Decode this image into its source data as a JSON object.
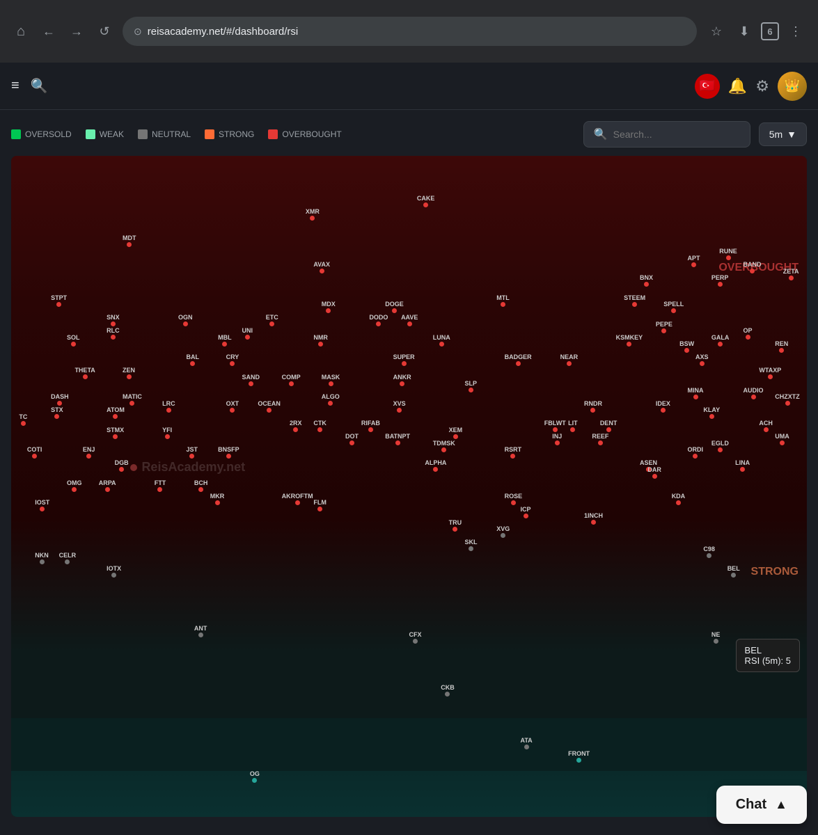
{
  "browser": {
    "url": "reisacademy.net/#/dashboard/rsi",
    "tab_count": "6",
    "nav": {
      "home": "⌂",
      "back": "←",
      "forward": "→",
      "refresh": "↺",
      "bookmark": "☆",
      "download": "⬇",
      "more": "⋮"
    }
  },
  "header": {
    "hamburger": "≡",
    "search": "🔍",
    "flag": "🇹🇷",
    "bell": "🔔",
    "settings": "⚙"
  },
  "dashboard": {
    "legend": [
      {
        "label": "OVERSOLD",
        "class": "dot-oversold"
      },
      {
        "label": "WEAK",
        "class": "dot-weak"
      },
      {
        "label": "NEUTRAL",
        "class": "dot-neutral"
      },
      {
        "label": "STRONG",
        "class": "dot-strong"
      },
      {
        "label": "OVERBOUGHT",
        "class": "dot-overbought"
      }
    ],
    "search_placeholder": "Search...",
    "time_selector": "5m",
    "watermark": "ReisAcademy.net",
    "zone_labels": {
      "overbought": "OVERBOUGHT",
      "strong": "STRONG"
    },
    "tooltip": {
      "token": "BEL",
      "rsi_label": "RSI (5m): 5"
    }
  },
  "tokens": [
    {
      "id": "XMR",
      "x": "37%",
      "y": "8%",
      "dot": "dot-red"
    },
    {
      "id": "CAKE",
      "x": "51%",
      "y": "6%",
      "dot": "dot-red"
    },
    {
      "id": "MDT",
      "x": "14%",
      "y": "12%",
      "dot": "dot-red"
    },
    {
      "id": "AVAX",
      "x": "38%",
      "y": "16%",
      "dot": "dot-red"
    },
    {
      "id": "MDX",
      "x": "39%",
      "y": "22%",
      "dot": "dot-red"
    },
    {
      "id": "STPT",
      "x": "5%",
      "y": "21%",
      "dot": "dot-red"
    },
    {
      "id": "SOL",
      "x": "7%",
      "y": "27%",
      "dot": "dot-red"
    },
    {
      "id": "SNX",
      "x": "12%",
      "y": "24%",
      "dot": "dot-red"
    },
    {
      "id": "RLC",
      "x": "12%",
      "y": "26%",
      "dot": "dot-red"
    },
    {
      "id": "OGN",
      "x": "21%",
      "y": "24%",
      "dot": "dot-red"
    },
    {
      "id": "MBL",
      "x": "26%",
      "y": "27%",
      "dot": "dot-red"
    },
    {
      "id": "UNI",
      "x": "29%",
      "y": "26%",
      "dot": "dot-red"
    },
    {
      "id": "ETC",
      "x": "32%",
      "y": "24%",
      "dot": "dot-red"
    },
    {
      "id": "NMR",
      "x": "38%",
      "y": "27%",
      "dot": "dot-red"
    },
    {
      "id": "DODO",
      "x": "45%",
      "y": "24%",
      "dot": "dot-red"
    },
    {
      "id": "AAVE",
      "x": "49%",
      "y": "24%",
      "dot": "dot-red"
    },
    {
      "id": "LUNA",
      "x": "53%",
      "y": "27%",
      "dot": "dot-red"
    },
    {
      "id": "DOGE",
      "x": "47%",
      "y": "22%",
      "dot": "dot-red"
    },
    {
      "id": "MTL",
      "x": "61%",
      "y": "21%",
      "dot": "dot-red"
    },
    {
      "id": "BAL",
      "x": "22%",
      "y": "30%",
      "dot": "dot-red"
    },
    {
      "id": "CRY",
      "x": "27%",
      "y": "30%",
      "dot": "dot-red"
    },
    {
      "id": "SAND",
      "x": "29%",
      "y": "33%",
      "dot": "dot-red"
    },
    {
      "id": "BNX",
      "x": "79%",
      "y": "18%",
      "dot": "dot-red"
    },
    {
      "id": "APT",
      "x": "85%",
      "y": "15%",
      "dot": "dot-red"
    },
    {
      "id": "RUNE",
      "x": "89%",
      "y": "14%",
      "dot": "dot-red"
    },
    {
      "id": "STEEM",
      "x": "77%",
      "y": "21%",
      "dot": "dot-red"
    },
    {
      "id": "SPELL",
      "x": "82%",
      "y": "22%",
      "dot": "dot-red"
    },
    {
      "id": "PEPE",
      "x": "81%",
      "y": "25%",
      "dot": "dot-red"
    },
    {
      "id": "PERP",
      "x": "88%",
      "y": "18%",
      "dot": "dot-red"
    },
    {
      "id": "BAND",
      "x": "92%",
      "y": "16%",
      "dot": "dot-red"
    },
    {
      "id": "ZETA",
      "x": "97%",
      "y": "17%",
      "dot": "dot-red"
    },
    {
      "id": "BSW",
      "x": "84%",
      "y": "28%",
      "dot": "dot-red"
    },
    {
      "id": "AXS",
      "x": "86%",
      "y": "30%",
      "dot": "dot-red"
    },
    {
      "id": "GALA",
      "x": "88%",
      "y": "27%",
      "dot": "dot-red"
    },
    {
      "id": "OP",
      "x": "92%",
      "y": "26%",
      "dot": "dot-red"
    },
    {
      "id": "REN",
      "x": "96%",
      "y": "28%",
      "dot": "dot-red"
    },
    {
      "id": "KSMKEY",
      "x": "76%",
      "y": "27%",
      "dot": "dot-red"
    },
    {
      "id": "NEAR",
      "x": "69%",
      "y": "30%",
      "dot": "dot-red"
    },
    {
      "id": "BADGER",
      "x": "62%",
      "y": "30%",
      "dot": "dot-red"
    },
    {
      "id": "SUPER",
      "x": "48%",
      "y": "30%",
      "dot": "dot-red"
    },
    {
      "id": "THETA",
      "x": "8%",
      "y": "32%",
      "dot": "dot-red"
    },
    {
      "id": "ZEN",
      "x": "14%",
      "y": "32%",
      "dot": "dot-red"
    },
    {
      "id": "MATIC",
      "x": "14%",
      "y": "36%",
      "dot": "dot-red"
    },
    {
      "id": "DASH",
      "x": "5%",
      "y": "36%",
      "dot": "dot-red"
    },
    {
      "id": "STX",
      "x": "5%",
      "y": "38%",
      "dot": "dot-red"
    },
    {
      "id": "ATOM",
      "x": "12%",
      "y": "38%",
      "dot": "dot-red"
    },
    {
      "id": "LRC",
      "x": "19%",
      "y": "37%",
      "dot": "dot-red"
    },
    {
      "id": "COMP",
      "x": "34%",
      "y": "33%",
      "dot": "dot-red"
    },
    {
      "id": "MASK",
      "x": "39%",
      "y": "33%",
      "dot": "dot-red"
    },
    {
      "id": "ALGO",
      "x": "39%",
      "y": "36%",
      "dot": "dot-red"
    },
    {
      "id": "ANKR",
      "x": "48%",
      "y": "33%",
      "dot": "dot-red"
    },
    {
      "id": "XVS",
      "x": "48%",
      "y": "37%",
      "dot": "dot-red"
    },
    {
      "id": "SLP",
      "x": "57%",
      "y": "34%",
      "dot": "dot-red"
    },
    {
      "id": "IDEX",
      "x": "81%",
      "y": "37%",
      "dot": "dot-red"
    },
    {
      "id": "MINA",
      "x": "85%",
      "y": "35%",
      "dot": "dot-red"
    },
    {
      "id": "KLAY",
      "x": "87%",
      "y": "38%",
      "dot": "dot-red"
    },
    {
      "id": "WTAXP",
      "x": "94%",
      "y": "32%",
      "dot": "dot-red"
    },
    {
      "id": "AUDIO",
      "x": "92%",
      "y": "35%",
      "dot": "dot-red"
    },
    {
      "id": "CHZXTZ",
      "x": "96%",
      "y": "36%",
      "dot": "dot-red"
    },
    {
      "id": "TC",
      "x": "1%",
      "y": "39%",
      "dot": "dot-red"
    },
    {
      "id": "OXT",
      "x": "27%",
      "y": "37%",
      "dot": "dot-red"
    },
    {
      "id": "OCEAN",
      "x": "31%",
      "y": "37%",
      "dot": "dot-red"
    },
    {
      "id": "2RX",
      "x": "35%",
      "y": "40%",
      "dot": "dot-red"
    },
    {
      "id": "STMX",
      "x": "12%",
      "y": "41%",
      "dot": "dot-red"
    },
    {
      "id": "YFI",
      "x": "19%",
      "y": "41%",
      "dot": "dot-red"
    },
    {
      "id": "CTK",
      "x": "38%",
      "y": "40%",
      "dot": "dot-red"
    },
    {
      "id": "DOT",
      "x": "42%",
      "y": "42%",
      "dot": "dot-red"
    },
    {
      "id": "RIFAB",
      "x": "44%",
      "y": "40%",
      "dot": "dot-red"
    },
    {
      "id": "BATNPT",
      "x": "47%",
      "y": "42%",
      "dot": "dot-red"
    },
    {
      "id": "XEM",
      "x": "55%",
      "y": "41%",
      "dot": "dot-red"
    },
    {
      "id": "LIT",
      "x": "70%",
      "y": "40%",
      "dot": "dot-red"
    },
    {
      "id": "FBLWT",
      "x": "67%",
      "y": "40%",
      "dot": "dot-red"
    },
    {
      "id": "DENT",
      "x": "74%",
      "y": "40%",
      "dot": "dot-red"
    },
    {
      "id": "RNDR",
      "x": "72%",
      "y": "37%",
      "dot": "dot-red"
    },
    {
      "id": "INJ",
      "x": "68%",
      "y": "42%",
      "dot": "dot-red"
    },
    {
      "id": "REEF",
      "x": "73%",
      "y": "42%",
      "dot": "dot-red"
    },
    {
      "id": "ACH",
      "x": "94%",
      "y": "40%",
      "dot": "dot-red"
    },
    {
      "id": "UMA",
      "x": "96%",
      "y": "42%",
      "dot": "dot-red"
    },
    {
      "id": "ENJ",
      "x": "9%",
      "y": "44%",
      "dot": "dot-red"
    },
    {
      "id": "COTI",
      "x": "2%",
      "y": "44%",
      "dot": "dot-red"
    },
    {
      "id": "DGB",
      "x": "13%",
      "y": "46%",
      "dot": "dot-red"
    },
    {
      "id": "JST",
      "x": "22%",
      "y": "44%",
      "dot": "dot-red"
    },
    {
      "id": "BNSFP",
      "x": "26%",
      "y": "44%",
      "dot": "dot-red"
    },
    {
      "id": "ALPHA",
      "x": "52%",
      "y": "46%",
      "dot": "dot-red"
    },
    {
      "id": "TDMSK",
      "x": "53%",
      "y": "43%",
      "dot": "dot-red"
    },
    {
      "id": "RSRT",
      "x": "62%",
      "y": "44%",
      "dot": "dot-red"
    },
    {
      "id": "ASEN",
      "x": "79%",
      "y": "46%",
      "dot": "dot-red"
    },
    {
      "id": "DAR",
      "x": "80%",
      "y": "47%",
      "dot": "dot-red"
    },
    {
      "id": "ORDI",
      "x": "85%",
      "y": "44%",
      "dot": "dot-red"
    },
    {
      "id": "EGLD",
      "x": "88%",
      "y": "43%",
      "dot": "dot-red"
    },
    {
      "id": "LINA",
      "x": "91%",
      "y": "46%",
      "dot": "dot-red"
    },
    {
      "id": "OMG",
      "x": "7%",
      "y": "49%",
      "dot": "dot-red"
    },
    {
      "id": "ARPA",
      "x": "11%",
      "y": "49%",
      "dot": "dot-red"
    },
    {
      "id": "FTT",
      "x": "18%",
      "y": "49%",
      "dot": "dot-red"
    },
    {
      "id": "BCH",
      "x": "23%",
      "y": "49%",
      "dot": "dot-red"
    },
    {
      "id": "MKR",
      "x": "25%",
      "y": "51%",
      "dot": "dot-red"
    },
    {
      "id": "IOST",
      "x": "3%",
      "y": "52%",
      "dot": "dot-red"
    },
    {
      "id": "AKROFTM",
      "x": "34%",
      "y": "51%",
      "dot": "dot-red"
    },
    {
      "id": "FLM",
      "x": "38%",
      "y": "52%",
      "dot": "dot-red"
    },
    {
      "id": "ROSE",
      "x": "62%",
      "y": "51%",
      "dot": "dot-red"
    },
    {
      "id": "ICP",
      "x": "64%",
      "y": "53%",
      "dot": "dot-red"
    },
    {
      "id": "KDA",
      "x": "83%",
      "y": "51%",
      "dot": "dot-red"
    },
    {
      "id": "TRU",
      "x": "55%",
      "y": "55%",
      "dot": "dot-red"
    },
    {
      "id": "1INCH",
      "x": "72%",
      "y": "54%",
      "dot": "dot-red"
    },
    {
      "id": "SKL",
      "x": "57%",
      "y": "58%",
      "dot": "dot-gray"
    },
    {
      "id": "XVG",
      "x": "61%",
      "y": "56%",
      "dot": "dot-gray"
    },
    {
      "id": "NKN",
      "x": "3%",
      "y": "60%",
      "dot": "dot-gray"
    },
    {
      "id": "CELR",
      "x": "6%",
      "y": "60%",
      "dot": "dot-gray"
    },
    {
      "id": "IOTX",
      "x": "12%",
      "y": "62%",
      "dot": "dot-gray"
    },
    {
      "id": "C98",
      "x": "87%",
      "y": "59%",
      "dot": "dot-gray"
    },
    {
      "id": "BEL",
      "x": "90%",
      "y": "62%",
      "dot": "dot-gray"
    },
    {
      "id": "ANT",
      "x": "23%",
      "y": "71%",
      "dot": "dot-gray"
    },
    {
      "id": "CFX",
      "x": "50%",
      "y": "72%",
      "dot": "dot-gray"
    },
    {
      "id": "NE",
      "x": "88%",
      "y": "72%",
      "dot": "dot-gray"
    },
    {
      "id": "CKB",
      "x": "54%",
      "y": "80%",
      "dot": "dot-gray"
    },
    {
      "id": "ATA",
      "x": "64%",
      "y": "88%",
      "dot": "dot-gray"
    },
    {
      "id": "FRONT",
      "x": "70%",
      "y": "90%",
      "dot": "dot-teal"
    },
    {
      "id": "OG",
      "x": "30%",
      "y": "93%",
      "dot": "dot-teal"
    }
  ],
  "chat": {
    "label": "Chat",
    "arrow": "▲"
  }
}
